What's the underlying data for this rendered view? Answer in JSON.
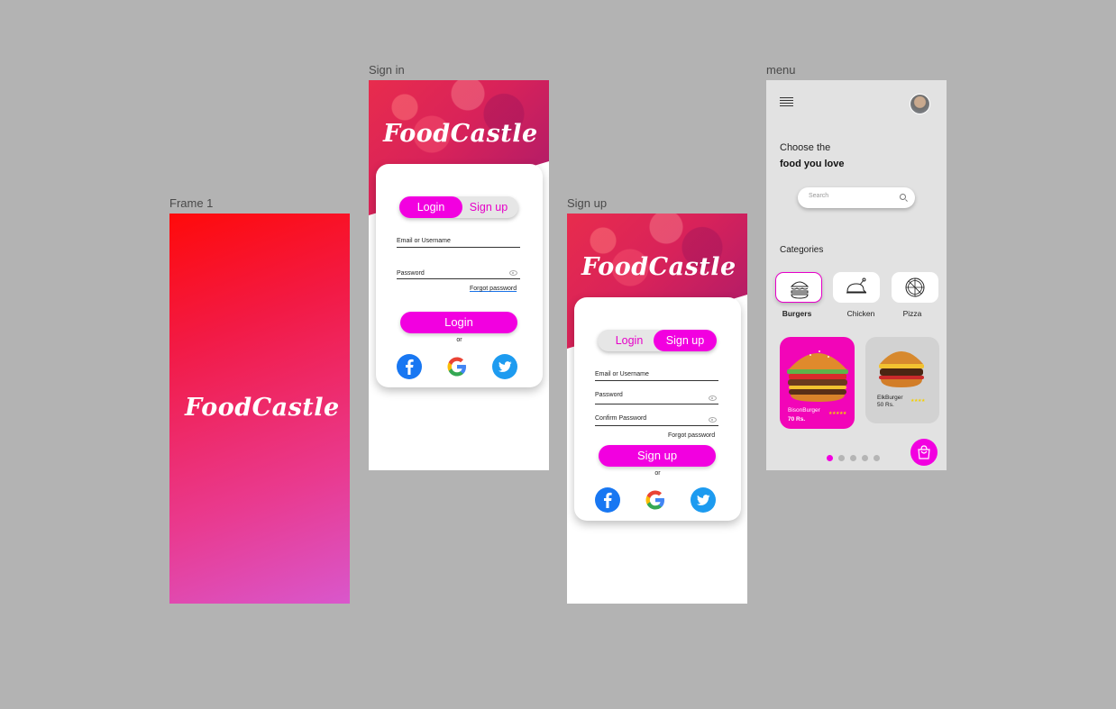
{
  "labels": {
    "frame1": "Frame 1",
    "signin": "Sign in",
    "signup": "Sign up",
    "menu": "menu"
  },
  "brand": {
    "name": "FoodCastle",
    "accent": "#f200e0"
  },
  "signin": {
    "tab_login": "Login",
    "tab_signup": "Sign up",
    "email_label": "Email or Username",
    "password_label": "Password",
    "forgot": "Forgot password",
    "submit": "Login",
    "or": "or"
  },
  "signup": {
    "tab_login": "Login",
    "tab_signup": "Sign up",
    "email_label": "Email or Username",
    "password_label": "Password",
    "confirm_label": "Confirm Password",
    "forgot": "Forgot password",
    "submit": "Sign up",
    "or": "or"
  },
  "social": [
    "facebook-icon",
    "google-icon",
    "twitter-icon"
  ],
  "menu": {
    "headline_line1": "Choose the",
    "headline_line2": "food you love",
    "search_placeholder": "Search",
    "categories_title": "Categories",
    "categories": [
      {
        "label": "Burgers",
        "icon": "burger-icon",
        "active": true
      },
      {
        "label": "Chicken",
        "icon": "chicken-icon",
        "active": false
      },
      {
        "label": "Pizza",
        "icon": "pizza-icon",
        "active": false
      }
    ],
    "items": [
      {
        "name": "BisonBurger",
        "price": "70 Rs.",
        "stars": "★★★★★"
      },
      {
        "name": "ElkBurger",
        "price": "50 Rs.",
        "stars": "★★★★"
      }
    ],
    "pagination": {
      "count": 5,
      "active": 1
    }
  }
}
